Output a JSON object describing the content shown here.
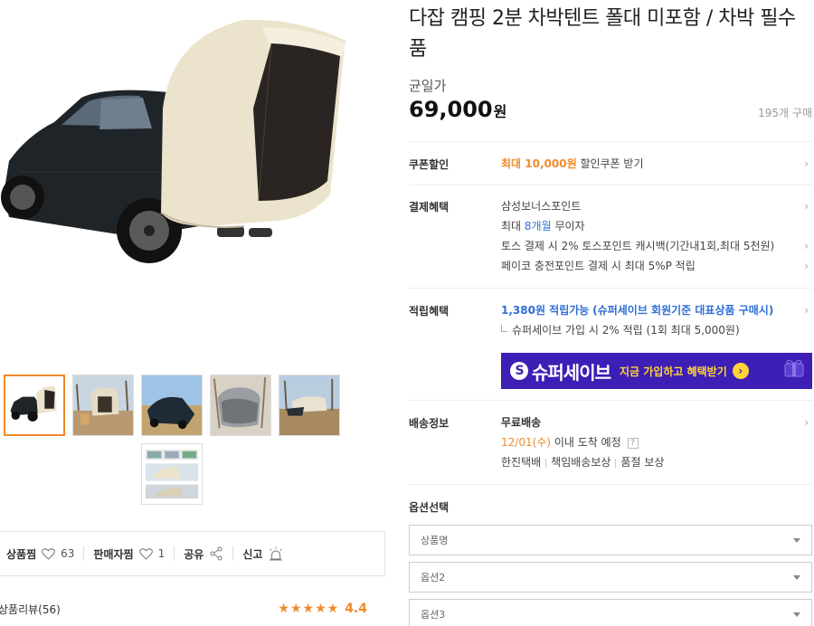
{
  "product": {
    "title": "다잡 캠핑 2분 차박텐트 폴대 미포함 / 차박 필수품",
    "price_label": "균일가",
    "price": "69,000",
    "currency": "원",
    "sold_count": "195개 구매"
  },
  "coupon": {
    "label": "쿠폰할인",
    "amount": "최대 10,000원",
    "text": "할인쿠폰 받기"
  },
  "payment": {
    "label": "결제혜택",
    "lines": [
      {
        "text": "삼성보너스포인트"
      },
      {
        "pre": "최대 ",
        "highlight": "8개월",
        "post": " 무이자"
      },
      {
        "text": "토스 결제 시 2% 토스포인트 캐시백(기간내1회,최대 5천원)"
      },
      {
        "text": "페이코 충전포인트 결제 시 최대 5%P 적립"
      }
    ]
  },
  "points": {
    "label": "적립혜택",
    "amount": "1,380원 적립가능",
    "condition": "(슈퍼세이브 회원기준 대표상품 구매시)",
    "note": "슈퍼세이브 가입 시 2% 적립 (1회 최대 5,000원)",
    "banner_brand": "슈퍼세이브",
    "banner_logo": "S",
    "banner_cta": "지금 가입하고 혜택받기",
    "banner_cta_icon": "›"
  },
  "shipping": {
    "label": "배송정보",
    "fee": "무료배송",
    "date": "12/01(수)",
    "date_suffix": " 이내 도착 예정",
    "help": "?",
    "carrier": "한진택배",
    "guarantee": "책임배송보상",
    "soldout": "품절 보상"
  },
  "options": {
    "title": "옵션선택",
    "selects": [
      {
        "placeholder": "상품명"
      },
      {
        "placeholder": "옵션2"
      },
      {
        "placeholder": "옵션3"
      }
    ]
  },
  "actions": {
    "wish_label": "상품찜",
    "wish_count": "63",
    "seller_label": "판매자찜",
    "seller_count": "1",
    "share_label": "공유",
    "report_label": "신고"
  },
  "reviews": {
    "label": "상품리뷰(56)",
    "stars": "★★★★★",
    "rating": "4.4"
  },
  "chevron": "›",
  "colors": {
    "accent": "#f08a2a",
    "link_blue": "#2f6fd6",
    "banner_purple": "#3d1fb5",
    "banner_yellow": "#ffd43b"
  }
}
